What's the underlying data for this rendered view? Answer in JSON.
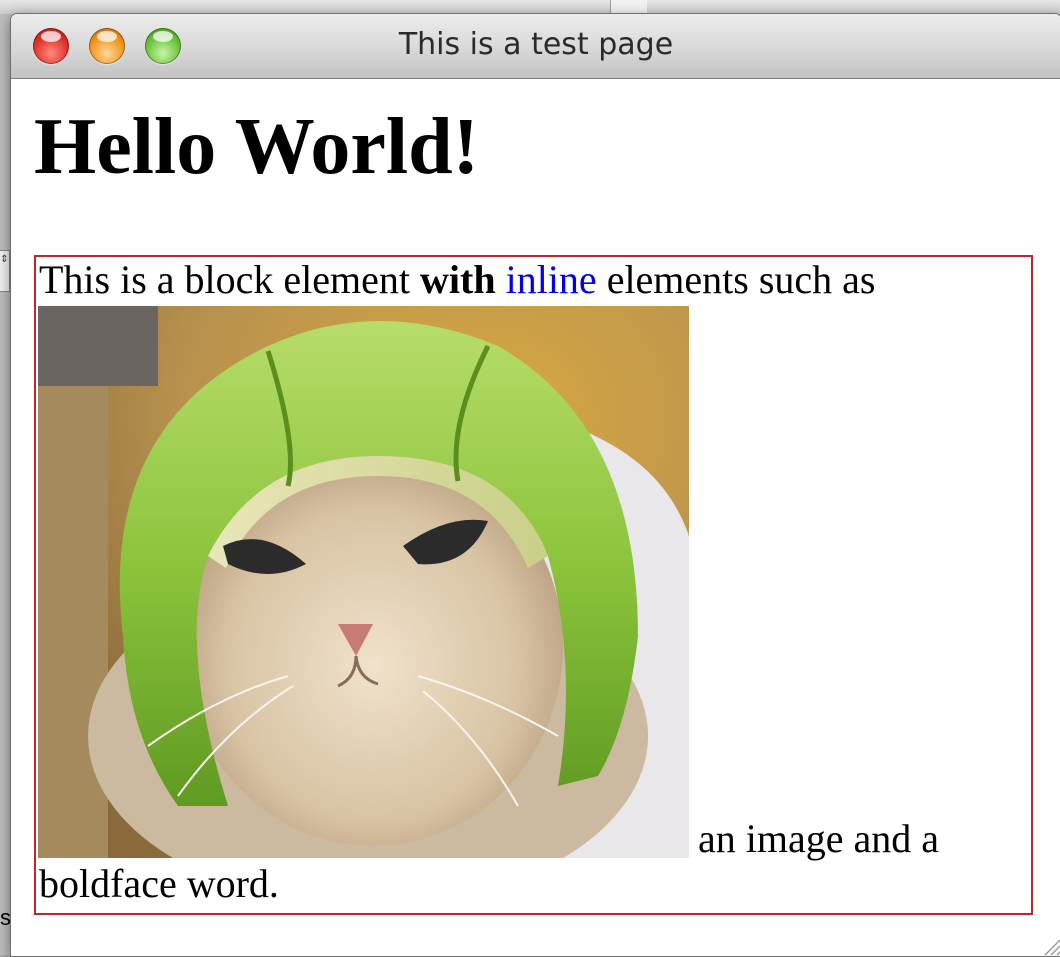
{
  "window": {
    "title": "This is a test page",
    "controls": [
      "close",
      "minimize",
      "zoom"
    ]
  },
  "page": {
    "heading": "Hello World!",
    "paragraph": {
      "text_before_bold": "This is a block element ",
      "bold_word": "with",
      "space1": " ",
      "link_text": "inline",
      "text_after_link": " elements such as",
      "text_after_image": "an image and a",
      "text_end": "boldface word."
    },
    "image_icon": "cat-with-lime-helmet-image"
  },
  "background": {
    "cut_text": "st",
    "stepper_glyph": "⇕"
  },
  "colors": {
    "link": "#0000ee",
    "block_border": "#c3252c"
  }
}
